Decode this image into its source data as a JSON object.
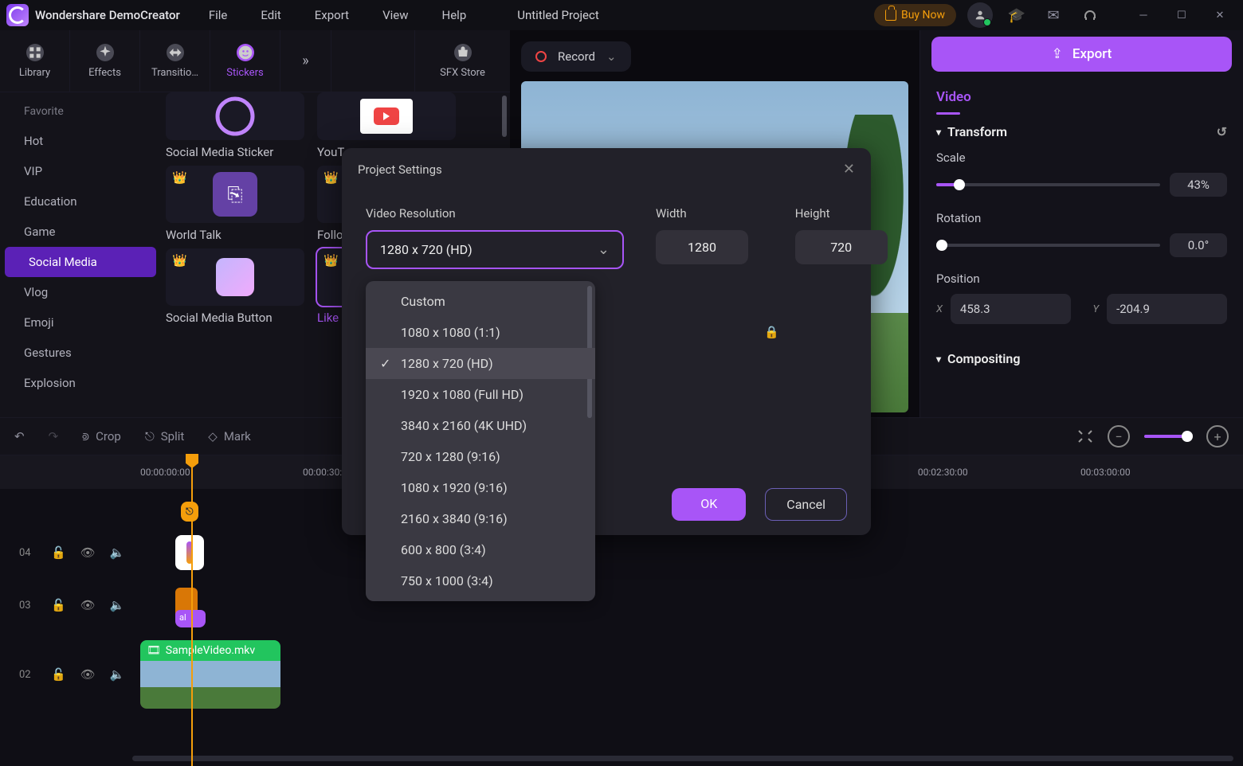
{
  "app_name": "Wondershare DemoCreator",
  "project_name": "Untitled Project",
  "menu": {
    "file": "File",
    "edit": "Edit",
    "export": "Export",
    "view": "View",
    "help": "Help"
  },
  "buy_now": "Buy Now",
  "export_btn": "Export",
  "tabs": {
    "library": "Library",
    "effects": "Effects",
    "transitions": "Transitio…",
    "stickers": "Stickers",
    "more": "»",
    "sfx": "SFX Store"
  },
  "categories": [
    "Favorite",
    "Hot",
    "VIP",
    "Education",
    "Game",
    "Social Media",
    "Vlog",
    "Emoji",
    "Gestures",
    "Explosion"
  ],
  "active_category": "Social Media",
  "thumbs": [
    {
      "label": "Social Media Sticker"
    },
    {
      "label": "YouT"
    },
    {
      "label": "World Talk"
    },
    {
      "label": "Follo"
    },
    {
      "label": "Social Media Button"
    },
    {
      "label": "Like"
    }
  ],
  "record": "Record",
  "video_tab": "Video",
  "transform": {
    "title": "Transform",
    "scale_label": "Scale",
    "scale_value": "43%",
    "rotation_label": "Rotation",
    "rotation_value": "0.0°",
    "position_label": "Position",
    "x": "458.3",
    "y": "-204.9"
  },
  "compositing": "Compositing",
  "toolbar": {
    "crop": "Crop",
    "split": "Split",
    "mark": "Mark"
  },
  "time_ticks": [
    "00:00:00:00",
    "00:00:30:",
    "00:02:30:00",
    "00:03:00:00"
  ],
  "tracks": {
    "t4": "04",
    "t3": "03",
    "t2": "02"
  },
  "clip_name": "SampleVideo.mkv",
  "split_tag": "al",
  "modal": {
    "title": "Project Settings",
    "resolution_label": "Video Resolution",
    "resolution_value": "1280 x 720 (HD)",
    "width_label": "Width",
    "width": "1280",
    "height_label": "Height",
    "height": "720",
    "options": [
      "Custom",
      "1080 x 1080 (1:1)",
      "1280 x 720 (HD)",
      "1920 x 1080 (Full HD)",
      "3840 x 2160 (4K UHD)",
      "720 x 1280 (9:16)",
      "1080 x 1920 (9:16)",
      "2160 x 3840 (9:16)",
      "600 x 800 (3:4)",
      "750 x 1000 (3:4)"
    ],
    "ok": "OK",
    "cancel": "Cancel"
  }
}
